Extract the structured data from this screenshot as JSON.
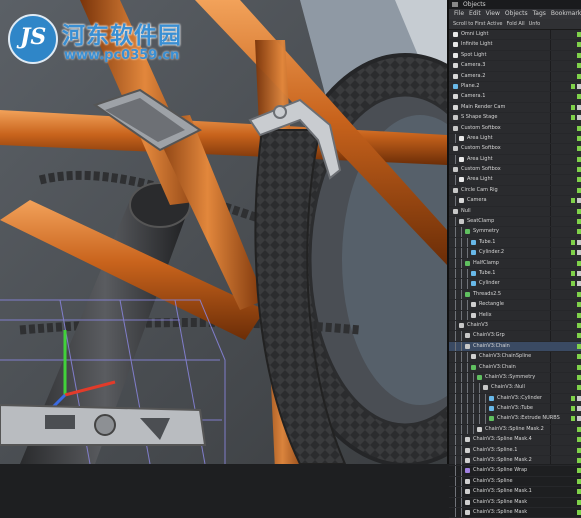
{
  "watermark": {
    "title": "河东软件园",
    "url": "www.pc0359.cn"
  },
  "panel": {
    "title": "Objects",
    "menu": [
      "File",
      "Edit",
      "View",
      "Objects",
      "Tags",
      "Bookmarks"
    ],
    "toolbar": [
      "Scroll to First Active",
      "Fold All",
      "Unfo"
    ],
    "tree": [
      {
        "label": "Omni Light",
        "depth": 0,
        "icon": "light-icon",
        "color": "#e8e8e8",
        "tags": [
          "check"
        ]
      },
      {
        "label": "Infinite Light",
        "depth": 0,
        "icon": "light-icon",
        "color": "#e8e8e8",
        "tags": [
          "check"
        ]
      },
      {
        "label": "Spot Light",
        "depth": 0,
        "icon": "light-icon",
        "color": "#e8e8e8",
        "tags": [
          "check"
        ]
      },
      {
        "label": "Camera.3",
        "depth": 0,
        "icon": "camera-icon",
        "color": "#d8d8d8",
        "tags": [
          "check"
        ]
      },
      {
        "label": "Camera.2",
        "depth": 0,
        "icon": "camera-icon",
        "color": "#d8d8d8",
        "tags": [
          "check"
        ]
      },
      {
        "label": "Plane.2",
        "depth": 0,
        "icon": "plane-icon",
        "color": "#68b8e8",
        "tags": [
          "check",
          "tag"
        ]
      },
      {
        "label": "Camera.1",
        "depth": 0,
        "icon": "camera-icon",
        "color": "#d8d8d8",
        "tags": [
          "check"
        ]
      },
      {
        "label": "Main Render Cam",
        "depth": 0,
        "icon": "camera-icon",
        "color": "#d8d8d8",
        "tags": [
          "check",
          "tag"
        ]
      },
      {
        "label": "S Shape Stage",
        "depth": 0,
        "icon": "stage-icon",
        "color": "#c8c8c8",
        "tags": [
          "check",
          "tag"
        ]
      },
      {
        "label": "Custom Softbox",
        "depth": 0,
        "icon": "null-icon",
        "color": "#c8c8c8",
        "tags": [
          "check"
        ]
      },
      {
        "label": "Area Light",
        "depth": 1,
        "icon": "light-icon",
        "color": "#e8e8e8",
        "tags": [
          "check"
        ]
      },
      {
        "label": "Custom Softbox",
        "depth": 0,
        "icon": "null-icon",
        "color": "#c8c8c8",
        "tags": [
          "check"
        ]
      },
      {
        "label": "Area Light",
        "depth": 1,
        "icon": "light-icon",
        "color": "#e8e8e8",
        "tags": [
          "check"
        ]
      },
      {
        "label": "Custom Softbox",
        "depth": 0,
        "icon": "null-icon",
        "color": "#c8c8c8",
        "tags": [
          "check"
        ]
      },
      {
        "label": "Area Light",
        "depth": 1,
        "icon": "light-icon",
        "color": "#e8e8e8",
        "tags": [
          "check"
        ]
      },
      {
        "label": "Circle Cam Rig",
        "depth": 0,
        "icon": "null-icon",
        "color": "#c8c8c8",
        "tags": [
          "check"
        ]
      },
      {
        "label": "Camera",
        "depth": 1,
        "icon": "camera-icon",
        "color": "#d8d8d8",
        "tags": [
          "check",
          "tag"
        ]
      },
      {
        "label": "Null",
        "depth": 0,
        "icon": "null-icon",
        "color": "#c8c8c8",
        "tags": [
          "check"
        ]
      },
      {
        "label": "SeatClamp",
        "depth": 1,
        "icon": "null-icon",
        "color": "#c8c8c8",
        "tags": [
          "check"
        ]
      },
      {
        "label": "Symmetry",
        "depth": 2,
        "icon": "symmetry-icon",
        "color": "#60c060",
        "tags": [
          "check"
        ]
      },
      {
        "label": "Tube.1",
        "depth": 3,
        "icon": "tube-icon",
        "color": "#68b8e8",
        "tags": [
          "check",
          "tag"
        ]
      },
      {
        "label": "Cylinder.2",
        "depth": 3,
        "icon": "cylinder-icon",
        "color": "#68b8e8",
        "tags": [
          "check",
          "tag"
        ]
      },
      {
        "label": "HalfClamp",
        "depth": 2,
        "icon": "symmetry-icon",
        "color": "#60c060",
        "tags": [
          "check"
        ]
      },
      {
        "label": "Tube.1",
        "depth": 3,
        "icon": "tube-icon",
        "color": "#68b8e8",
        "tags": [
          "check",
          "tag"
        ]
      },
      {
        "label": "Cylinder",
        "depth": 3,
        "icon": "cylinder-icon",
        "color": "#68b8e8",
        "tags": [
          "check",
          "tag"
        ]
      },
      {
        "label": "Threads2.5",
        "depth": 2,
        "icon": "sweep-icon",
        "color": "#60c060",
        "tags": [
          "check"
        ]
      },
      {
        "label": "Rectangle",
        "depth": 3,
        "icon": "spline-icon",
        "color": "#cfcfcf",
        "tags": [
          "check"
        ]
      },
      {
        "label": "Helix",
        "depth": 3,
        "icon": "spline-icon",
        "color": "#cfcfcf",
        "tags": [
          "check"
        ]
      },
      {
        "label": "ChainV3",
        "depth": 1,
        "icon": "null-icon",
        "color": "#c8c8c8",
        "tags": [
          "check"
        ]
      },
      {
        "label": "ChainV3:Grp",
        "depth": 2,
        "icon": "null-icon",
        "color": "#c8c8c8",
        "tags": [
          "check"
        ]
      },
      {
        "label": "ChainV3:Chain",
        "depth": 2,
        "icon": "null-icon",
        "color": "#c8c8c8",
        "tags": [
          "check"
        ]
      },
      {
        "label": "ChainV3:ChainSpline",
        "depth": 3,
        "icon": "spline-icon",
        "color": "#cfcfcf",
        "tags": [
          "check"
        ]
      },
      {
        "label": "ChainV3:Chain",
        "depth": 3,
        "icon": "cloner-icon",
        "color": "#60c060",
        "tags": [
          "check"
        ]
      },
      {
        "label": "ChainV3::Symmetry",
        "depth": 4,
        "icon": "symmetry-icon",
        "color": "#60c060",
        "tags": [
          "check"
        ]
      },
      {
        "label": "ChainV3::Null",
        "depth": 5,
        "icon": "null-icon",
        "color": "#c8c8c8",
        "tags": [
          "check"
        ]
      },
      {
        "label": "ChainV3::Cylinder",
        "depth": 6,
        "icon": "cylinder-icon",
        "color": "#68b8e8",
        "tags": [
          "check",
          "tag"
        ]
      },
      {
        "label": "ChainV3::Tube",
        "depth": 6,
        "icon": "tube-icon",
        "color": "#68b8e8",
        "tags": [
          "check",
          "tag"
        ]
      },
      {
        "label": "ChainV3::Extrude NURBS",
        "depth": 6,
        "icon": "extrude-icon",
        "color": "#60c060",
        "tags": [
          "check",
          "tag"
        ]
      },
      {
        "label": "ChainV3::Spline Mask.2",
        "depth": 4,
        "icon": "spline-icon",
        "color": "#cfcfcf",
        "tags": [
          "check"
        ]
      },
      {
        "label": "ChainV3::Spline Mask.4",
        "depth": 2,
        "icon": "spline-icon",
        "color": "#cfcfcf",
        "tags": [
          "check"
        ]
      },
      {
        "label": "ChainV3::Spline.1",
        "depth": 2,
        "icon": "spline-icon",
        "color": "#cfcfcf",
        "tags": [
          "check"
        ]
      },
      {
        "label": "ChainV3::Spline Mask.2",
        "depth": 2,
        "icon": "spline-icon",
        "color": "#cfcfcf",
        "tags": [
          "check"
        ]
      },
      {
        "label": "ChainV3::Spline Wrap",
        "depth": 2,
        "icon": "deformer-icon",
        "color": "#a080e0",
        "tags": [
          "check"
        ]
      },
      {
        "label": "ChainV3::Spline",
        "depth": 2,
        "icon": "spline-icon",
        "color": "#cfcfcf",
        "tags": [
          "check"
        ]
      },
      {
        "label": "ChainV3::Spline Mask.1",
        "depth": 2,
        "icon": "spline-icon",
        "color": "#cfcfcf",
        "tags": [
          "check"
        ]
      },
      {
        "label": "ChainV3::Spline Mask",
        "depth": 2,
        "icon": "spline-icon",
        "color": "#cfcfcf",
        "tags": [
          "check"
        ]
      },
      {
        "label": "ChainV3::Spline Mask",
        "depth": 2,
        "icon": "spline-icon",
        "color": "#cfcfcf",
        "tags": [
          "check"
        ]
      }
    ],
    "selected_index": 30,
    "tag_colors": {
      "check": "#7fd14a",
      "tag": "#c8c8c8"
    }
  },
  "colors": {
    "frame_orange": "#c8631c",
    "frame_highlight": "#f0a060",
    "tire": "#3c3d3f",
    "grid": "#8080e0",
    "background_wall": "#9aa3ad"
  }
}
